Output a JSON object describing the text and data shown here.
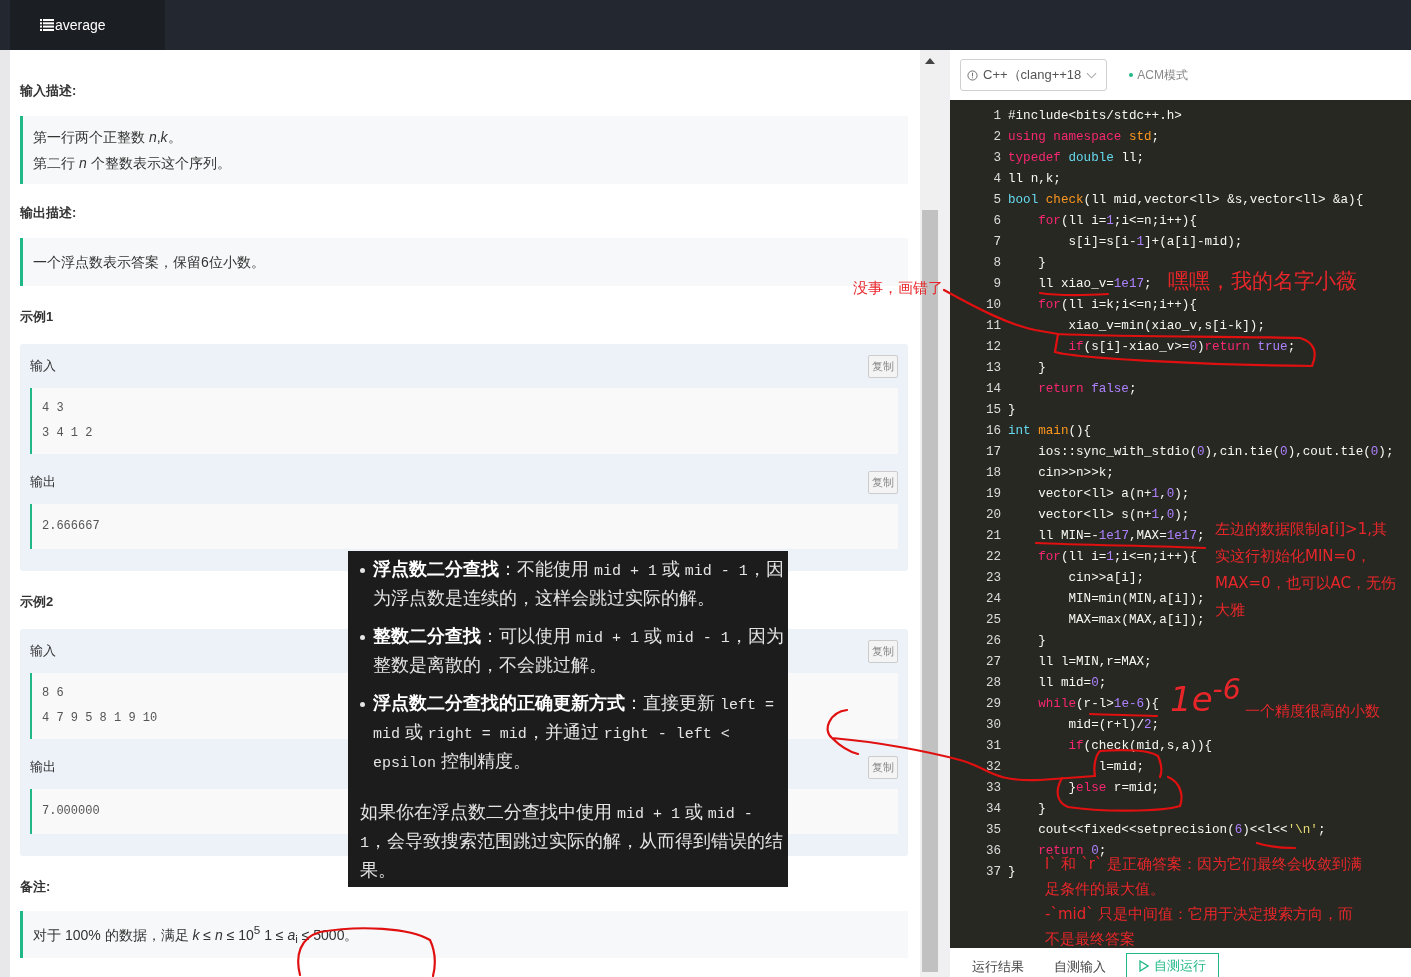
{
  "header": {
    "tab": "average"
  },
  "problem": {
    "input_title": "输入描述:",
    "input_lines": [
      "第一行两个正整数 *n*,*k*。",
      "第二行 *n* 个整数表示这个序列。"
    ],
    "output_title": "输出描述:",
    "output_lines": [
      "一个浮点数表示答案，保留6位小数。"
    ],
    "examples": [
      {
        "title": "示例1",
        "input_label": "输入",
        "input_lines": [
          "4 3",
          "3 4 1 2"
        ],
        "output_label": "输出",
        "output_lines": [
          "2.666667"
        ],
        "input_copy": "复制",
        "output_copy": "复制"
      },
      {
        "title": "示例2",
        "input_label": "输入",
        "input_lines": [
          "8 6",
          "4 7 9 5 8 1 9 10"
        ],
        "output_label": "输出",
        "output_lines": [
          "7.000000"
        ],
        "input_copy": "复制",
        "output_copy": "复制"
      }
    ],
    "note_title": "备注:",
    "note_lines": [
      "对于 100% 的数据，满足 *k* ≤ *n* ≤ 10$^{5}$ 1 ≤ *a*$_{i}$ ≤ 5000。"
    ]
  },
  "tooltip": {
    "bullets": [
      [
        {
          "text": "浮点数二分查找",
          "kind": "bold"
        },
        {
          "text": "：不能使用 ",
          "kind": "plain"
        },
        {
          "text": "mid + 1",
          "kind": "code"
        },
        {
          "text": " 或 ",
          "kind": "plain"
        },
        {
          "text": "mid - 1",
          "kind": "code"
        },
        {
          "text": "，因为浮点数是连续的，这样会跳过实际的解。",
          "kind": "plain"
        }
      ],
      [
        {
          "text": "整数二分查找",
          "kind": "bold"
        },
        {
          "text": "：可以使用 ",
          "kind": "plain"
        },
        {
          "text": "mid + 1",
          "kind": "code"
        },
        {
          "text": " 或 ",
          "kind": "plain"
        },
        {
          "text": "mid - 1",
          "kind": "code"
        },
        {
          "text": "，因为整数是离散的，不会跳过解。",
          "kind": "plain"
        }
      ],
      [
        {
          "text": "浮点数二分查找的正确更新方式",
          "kind": "bold"
        },
        {
          "text": "：直接更新 ",
          "kind": "plain"
        },
        {
          "text": "left = mid",
          "kind": "code"
        },
        {
          "text": " 或 ",
          "kind": "plain"
        },
        {
          "text": "right = mid",
          "kind": "code"
        },
        {
          "text": "，并通过 ",
          "kind": "plain"
        },
        {
          "text": "right - left < epsilon",
          "kind": "code"
        },
        {
          "text": " 控制精度。",
          "kind": "plain"
        }
      ]
    ],
    "paragraph": [
      {
        "text": "如果你在浮点数二分查找中使用 ",
        "kind": "plain"
      },
      {
        "text": "mid + 1",
        "kind": "code"
      },
      {
        "text": " 或 ",
        "kind": "plain"
      },
      {
        "text": "mid - 1",
        "kind": "code"
      },
      {
        "text": "，会导致搜索范围跳过实际的解，从而得到错误的结果。",
        "kind": "plain"
      }
    ]
  },
  "editor": {
    "language": "C++（clang++18",
    "mode": "ACM模式",
    "lines": [
      {
        "n": "1",
        "tokens": [
          {
            "text": "#include<bits/stdc++.h>",
            "kind": "plain"
          }
        ]
      },
      {
        "n": "2",
        "tokens": [
          {
            "text": "using namespace ",
            "kind": "keyword"
          },
          {
            "text": "std",
            "kind": "function"
          },
          {
            "text": ";",
            "kind": "plain"
          }
        ]
      },
      {
        "n": "3",
        "tokens": [
          {
            "text": "typedef ",
            "kind": "keyword"
          },
          {
            "text": "double",
            "kind": "type"
          },
          {
            "text": " ll;",
            "kind": "plain"
          }
        ]
      },
      {
        "n": "4",
        "tokens": [
          {
            "text": "ll n,k;",
            "kind": "plain"
          }
        ]
      },
      {
        "n": "5",
        "tokens": [
          {
            "text": "bool ",
            "kind": "type"
          },
          {
            "text": "check",
            "kind": "function"
          },
          {
            "text": "(ll mid,vector<ll> &s,vector<ll> &a){",
            "kind": "plain"
          }
        ]
      },
      {
        "n": "6",
        "tokens": [
          {
            "text": "\tfor",
            "kind": "keyword"
          },
          {
            "text": "(ll i=",
            "kind": "plain"
          },
          {
            "text": "1",
            "kind": "number"
          },
          {
            "text": ";i<=n;i++){",
            "kind": "plain"
          }
        ]
      },
      {
        "n": "7",
        "tokens": [
          {
            "text": "\t\ts[i]=s[i-",
            "kind": "plain"
          },
          {
            "text": "1",
            "kind": "number"
          },
          {
            "text": "]+(a[i]-mid);",
            "kind": "plain"
          }
        ]
      },
      {
        "n": "8",
        "tokens": [
          {
            "text": "\t}",
            "kind": "plain"
          }
        ]
      },
      {
        "n": "9",
        "tokens": [
          {
            "text": "\tll xiao_v=",
            "kind": "plain"
          },
          {
            "text": "1e17",
            "kind": "number"
          },
          {
            "text": ";",
            "kind": "plain"
          }
        ]
      },
      {
        "n": "10",
        "tokens": [
          {
            "text": "\tfor",
            "kind": "keyword"
          },
          {
            "text": "(ll i=k;i<=n;i++){",
            "kind": "plain"
          }
        ]
      },
      {
        "n": "11",
        "tokens": [
          {
            "text": "\t\txiao_v=min(xiao_v,s[i-k]);",
            "kind": "plain"
          }
        ]
      },
      {
        "n": "12",
        "tokens": [
          {
            "text": "\t\tif",
            "kind": "keyword"
          },
          {
            "text": "(s[i]-xiao_v>=",
            "kind": "plain"
          },
          {
            "text": "0",
            "kind": "number"
          },
          {
            "text": ")",
            "kind": "plain"
          },
          {
            "text": "return ",
            "kind": "keyword"
          },
          {
            "text": "true",
            "kind": "number"
          },
          {
            "text": ";",
            "kind": "plain"
          }
        ]
      },
      {
        "n": "13",
        "tokens": [
          {
            "text": "\t}",
            "kind": "plain"
          }
        ]
      },
      {
        "n": "14",
        "tokens": [
          {
            "text": "\treturn ",
            "kind": "keyword"
          },
          {
            "text": "false",
            "kind": "number"
          },
          {
            "text": ";",
            "kind": "plain"
          }
        ]
      },
      {
        "n": "15",
        "tokens": [
          {
            "text": "}",
            "kind": "plain"
          }
        ]
      },
      {
        "n": "16",
        "tokens": [
          {
            "text": "int ",
            "kind": "type"
          },
          {
            "text": "main",
            "kind": "function"
          },
          {
            "text": "(){",
            "kind": "plain"
          }
        ]
      },
      {
        "n": "17",
        "tokens": [
          {
            "text": "\tios::sync_with_stdio(",
            "kind": "plain"
          },
          {
            "text": "0",
            "kind": "number"
          },
          {
            "text": "),cin.tie(",
            "kind": "plain"
          },
          {
            "text": "0",
            "kind": "number"
          },
          {
            "text": "),cout.tie(",
            "kind": "plain"
          },
          {
            "text": "0",
            "kind": "number"
          },
          {
            "text": ");",
            "kind": "plain"
          }
        ]
      },
      {
        "n": "18",
        "tokens": [
          {
            "text": "\tcin>>n>>k;",
            "kind": "plain"
          }
        ]
      },
      {
        "n": "19",
        "tokens": [
          {
            "text": "\tvector<ll> a(n+",
            "kind": "plain"
          },
          {
            "text": "1",
            "kind": "number"
          },
          {
            "text": ",",
            "kind": "plain"
          },
          {
            "text": "0",
            "kind": "number"
          },
          {
            "text": ");",
            "kind": "plain"
          }
        ]
      },
      {
        "n": "20",
        "tokens": [
          {
            "text": "\tvector<ll> s(n+",
            "kind": "plain"
          },
          {
            "text": "1",
            "kind": "number"
          },
          {
            "text": ",",
            "kind": "plain"
          },
          {
            "text": "0",
            "kind": "number"
          },
          {
            "text": ");",
            "kind": "plain"
          }
        ]
      },
      {
        "n": "21",
        "tokens": [
          {
            "text": "\tll MIN=-",
            "kind": "plain"
          },
          {
            "text": "1e17",
            "kind": "number"
          },
          {
            "text": ",MAX=",
            "kind": "plain"
          },
          {
            "text": "1e17",
            "kind": "number"
          },
          {
            "text": ";",
            "kind": "plain"
          }
        ]
      },
      {
        "n": "22",
        "tokens": [
          {
            "text": "\tfor",
            "kind": "keyword"
          },
          {
            "text": "(ll i=",
            "kind": "plain"
          },
          {
            "text": "1",
            "kind": "number"
          },
          {
            "text": ";i<=n;i++){",
            "kind": "plain"
          }
        ]
      },
      {
        "n": "23",
        "tokens": [
          {
            "text": "\t\tcin>>a[i];",
            "kind": "plain"
          }
        ]
      },
      {
        "n": "24",
        "tokens": [
          {
            "text": "\t\tMIN=min(MIN,a[i]);",
            "kind": "plain"
          }
        ]
      },
      {
        "n": "25",
        "tokens": [
          {
            "text": "\t\tMAX=max(MAX,a[i]);",
            "kind": "plain"
          }
        ]
      },
      {
        "n": "26",
        "tokens": [
          {
            "text": "\t}",
            "kind": "plain"
          }
        ]
      },
      {
        "n": "27",
        "tokens": [
          {
            "text": "\tll l=MIN,r=MAX;",
            "kind": "plain"
          }
        ]
      },
      {
        "n": "28",
        "tokens": [
          {
            "text": "\tll mid=",
            "kind": "plain"
          },
          {
            "text": "0",
            "kind": "number"
          },
          {
            "text": ";",
            "kind": "plain"
          }
        ]
      },
      {
        "n": "29",
        "tokens": [
          {
            "text": "\twhile",
            "kind": "keyword"
          },
          {
            "text": "(r-l>",
            "kind": "plain"
          },
          {
            "text": "1e-6",
            "kind": "number"
          },
          {
            "text": "){",
            "kind": "plain"
          }
        ]
      },
      {
        "n": "30",
        "tokens": [
          {
            "text": "\t\tmid=(r+l)/",
            "kind": "plain"
          },
          {
            "text": "2",
            "kind": "number"
          },
          {
            "text": ";",
            "kind": "plain"
          }
        ]
      },
      {
        "n": "31",
        "tokens": [
          {
            "text": "\t\tif",
            "kind": "keyword"
          },
          {
            "text": "(check(mid,s,a)){",
            "kind": "plain"
          }
        ]
      },
      {
        "n": "32",
        "tokens": [
          {
            "text": "\t\t\tl=mid;",
            "kind": "plain"
          }
        ]
      },
      {
        "n": "33",
        "tokens": [
          {
            "text": "\t\t}",
            "kind": "plain"
          },
          {
            "text": "else",
            "kind": "keyword"
          },
          {
            "text": " r=mid;",
            "kind": "plain"
          }
        ]
      },
      {
        "n": "34",
        "tokens": [
          {
            "text": "\t}",
            "kind": "plain"
          }
        ]
      },
      {
        "n": "35",
        "tokens": [
          {
            "text": "\tcout<<fixed<<setprecision(",
            "kind": "plain"
          },
          {
            "text": "6",
            "kind": "number"
          },
          {
            "text": ")<<l<<",
            "kind": "plain"
          },
          {
            "text": "'\\n'",
            "kind": "string"
          },
          {
            "text": ";",
            "kind": "plain"
          }
        ]
      },
      {
        "n": "36",
        "tokens": [
          {
            "text": "\treturn ",
            "kind": "keyword"
          },
          {
            "text": "0",
            "kind": "number"
          },
          {
            "text": ";",
            "kind": "plain"
          }
        ]
      },
      {
        "n": "37",
        "tokens": [
          {
            "text": "}",
            "kind": "plain"
          }
        ]
      }
    ]
  },
  "annotations": [
    {
      "lines": [
        "没事，画错了"
      ]
    },
    {
      "lines": [
        "嘿嘿，我的名字小薇"
      ]
    },
    {
      "lines": [
        "左边的数据限制a[i]>1,其",
        "实这行初始化MIN=0，",
        "MAX=0，也可以AC，无伤",
        "大雅"
      ]
    },
    {
      "lines": [
        "1e$^{-6}$"
      ]
    },
    {
      "lines": [
        "一个精度很高的小数"
      ]
    },
    {
      "lines": [
        "l` 和 `r` 是正确答案：因为它们最终会收敛到满",
        "足条件的最大值。",
        "-`mid` 只是中间值：它用于决定搜索方向，而",
        "不是最终答案"
      ]
    }
  ],
  "bottom_tabs": [
    {
      "label": "运行结果",
      "kind": "tab"
    },
    {
      "label": "自测输入",
      "kind": "tab"
    },
    {
      "label": "自测运行",
      "kind": "button"
    }
  ]
}
